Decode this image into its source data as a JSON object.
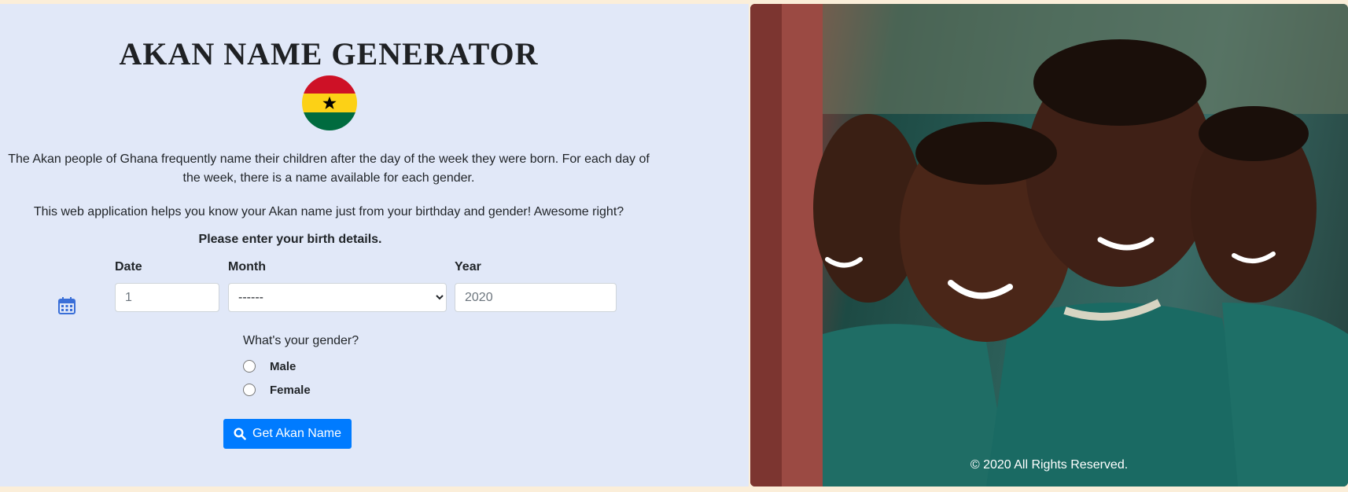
{
  "header": {
    "title": "AKAN NAME GENERATOR"
  },
  "intro": {
    "paragraph1": "The Akan people of Ghana frequently name their children after the day of the week they were born. For each day of the week, there is a name available for each gender.",
    "paragraph2": "This web application helps you know your Akan name just from your birthday and gender! Awesome right?"
  },
  "form": {
    "prompt": "Please enter your birth details.",
    "date": {
      "label": "Date",
      "placeholder": "1"
    },
    "month": {
      "label": "Month",
      "selected": "------"
    },
    "year": {
      "label": "Year",
      "placeholder": "2020"
    },
    "gender_question": "What's your gender?",
    "gender_options": [
      "Male",
      "Female"
    ],
    "submit_label": "Get Akan Name"
  },
  "footer": {
    "copyright": "© 2020 All Rights Reserved."
  },
  "icons": {
    "calendar": "calendar-icon",
    "search": "search-icon",
    "flag": "ghana-flag"
  },
  "colors": {
    "panel_background": "#e1e8f8",
    "page_background": "#fbeed9",
    "button": "#007bff",
    "calendar_icon": "#3a6fd8"
  }
}
